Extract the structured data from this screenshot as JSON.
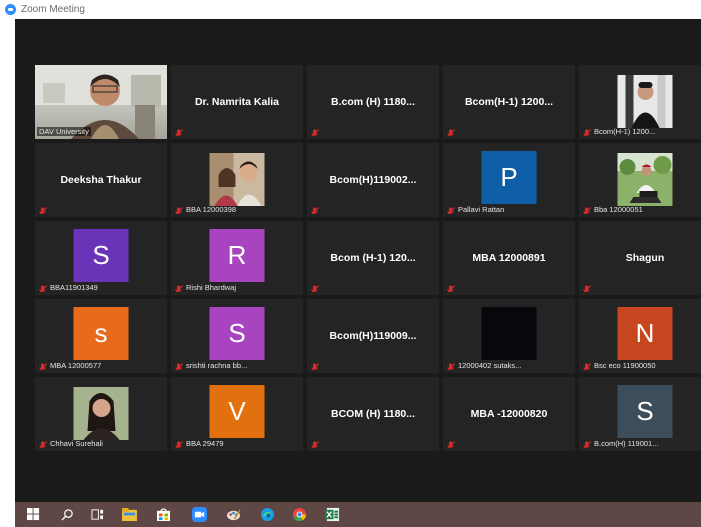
{
  "window": {
    "title": "Zoom Meeting"
  },
  "colors": {
    "active_speaker_border": "#d7e34a",
    "mute_icon": "#e02828",
    "taskbar": "#5e4745"
  },
  "participants": [
    {
      "name": "DAV University",
      "display": "video"
    },
    {
      "name": "Dr. Namrita Kalia",
      "display": "name"
    },
    {
      "name": "B.com (H) 1180...",
      "display": "name"
    },
    {
      "name": "Bcom(H-1) 1200...",
      "display": "name"
    },
    {
      "name": "Bcom(H-1) 1200...",
      "display": "photo"
    },
    {
      "name": "Deeksha Thakur",
      "display": "name"
    },
    {
      "name": "BBA 12000398",
      "display": "photo"
    },
    {
      "name": "Bcom(H)119002...",
      "display": "name"
    },
    {
      "name": "Pallavi Rattan",
      "display": "avatar",
      "avatar_letter": "P",
      "avatar_color": "#0e5fa8"
    },
    {
      "name": "Bba 12000051",
      "display": "photo"
    },
    {
      "name": "BBA11901349",
      "display": "avatar",
      "avatar_letter": "S",
      "avatar_color": "#6a34b8"
    },
    {
      "name": "Rishi Bhardwaj",
      "display": "avatar",
      "avatar_letter": "R",
      "avatar_color": "#a844c0"
    },
    {
      "name": "Bcom (H-1) 120...",
      "display": "name"
    },
    {
      "name": "MBA 12000891",
      "display": "name"
    },
    {
      "name": "Shagun",
      "display": "name"
    },
    {
      "name": "MBA 12000577",
      "display": "avatar",
      "avatar_letter": "s",
      "avatar_color": "#e86b1d"
    },
    {
      "name": "srishti rachna bb...",
      "display": "avatar",
      "avatar_letter": "S",
      "avatar_color": "#a844c0"
    },
    {
      "name": "Bcom(H)119009...",
      "display": "name"
    },
    {
      "name": "12000402 sutaks...",
      "display": "dark"
    },
    {
      "name": "Bsc eco 11900050",
      "display": "avatar",
      "avatar_letter": "N",
      "avatar_color": "#c8461f"
    },
    {
      "name": "Chhavi Surehali",
      "display": "photo"
    },
    {
      "name": "BBA 29479",
      "display": "avatar",
      "avatar_letter": "V",
      "avatar_color": "#e3700f"
    },
    {
      "name": "BCOM (H) 1180...",
      "display": "name"
    },
    {
      "name": "MBA -12000820",
      "display": "name"
    },
    {
      "name": "B.com(H) 119001...",
      "display": "avatar",
      "avatar_letter": "S",
      "avatar_color": "#3c4e5b"
    }
  ],
  "taskbar": {
    "items": [
      {
        "icon": "windows-start-icon"
      },
      {
        "icon": "search-icon"
      },
      {
        "icon": "task-view-icon"
      },
      {
        "icon": "file-explorer-icon"
      },
      {
        "icon": "store-icon"
      },
      {
        "icon": "zoom-icon"
      },
      {
        "icon": "paint-icon"
      },
      {
        "icon": "edge-icon"
      },
      {
        "icon": "chrome-icon"
      },
      {
        "icon": "excel-icon"
      }
    ]
  }
}
